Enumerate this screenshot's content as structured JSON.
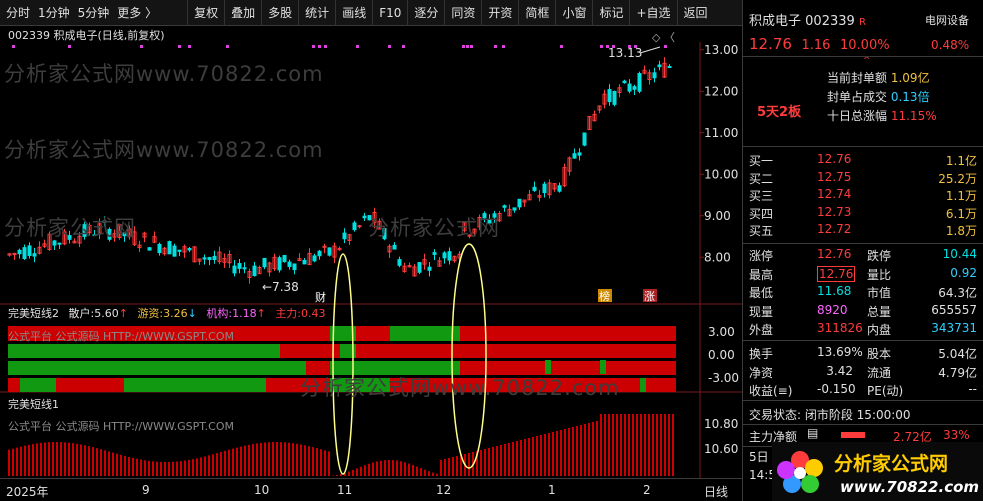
{
  "toolbar": {
    "left": [
      "分时",
      "1分钟",
      "5分钟",
      "更多 〉"
    ],
    "buttons": [
      "复权",
      "叠加",
      "多股",
      "统计",
      "画线",
      "F10",
      "逐分",
      "同资",
      "开资",
      "简框",
      "小窗",
      "标记",
      "+自选",
      "返回"
    ]
  },
  "chart_title": "002339 积成电子(日线,前复权)",
  "top_icons": "◇  〈",
  "watermark": "分析家公式网www.70822.com",
  "watermark_short": "分析家公式网",
  "annotations": {
    "high": "13.13",
    "low": "7.38",
    "cai": "财",
    "bang": "榜",
    "zhang": "涨"
  },
  "sub1": {
    "name": "完美短线2",
    "items": [
      {
        "label": "散户:",
        "value": "5.60",
        "color": "#e0e0e0",
        "arrow": "↑"
      },
      {
        "label": "游资:",
        "value": "3.26",
        "color": "#f0c040",
        "arrow": "↓"
      },
      {
        "label": "机构:",
        "value": "1.18",
        "color": "#ff66ff",
        "arrow": "↑"
      },
      {
        "label": "主力:",
        "value": "0.43",
        "color": "#ff3c3c",
        "arrow": ""
      }
    ],
    "axis": [
      "3.00",
      "0.00",
      "-3.00"
    ],
    "source_text": "公式平台 公式源码 HTTP://WWW.GSPT.COM"
  },
  "sub2": {
    "name": "完美短线1",
    "axis": [
      "10.80",
      "10.60"
    ],
    "source_text": "公式平台 公式源码 HTTP://WWW.GSPT.COM"
  },
  "xaxis": {
    "labels": [
      "2025年",
      "9",
      "10",
      "11",
      "12",
      "1",
      "2"
    ],
    "period": "日线"
  },
  "chart_data": {
    "type": "candlestick",
    "price_axis": [
      8.0,
      9.0,
      10.0,
      11.0,
      12.0,
      13.0
    ],
    "range": [
      7.0,
      13.5
    ],
    "high": 13.13,
    "low": 7.38,
    "last": 12.76
  },
  "right": {
    "name": "积成电子",
    "code": "002339",
    "flag": "R",
    "tag": "电网设备",
    "price": "12.76",
    "change": "1.16",
    "pct": "10.00%",
    "tag_pct": "0.48%",
    "limit_info": [
      {
        "label": "当前封单额",
        "value": "1.09亿"
      },
      {
        "label": "封单占成交",
        "value": "0.13倍"
      },
      {
        "label": "十日总涨幅",
        "value": "11.15%"
      }
    ],
    "streak": "5天2板",
    "bids": [
      {
        "label": "买一",
        "price": "12.76",
        "vol": "1.1亿"
      },
      {
        "label": "买二",
        "price": "12.75",
        "vol": "25.2万"
      },
      {
        "label": "买三",
        "price": "12.74",
        "vol": "1.1万"
      },
      {
        "label": "买四",
        "price": "12.73",
        "vol": "6.1万"
      },
      {
        "label": "买五",
        "price": "12.72",
        "vol": "1.8万"
      }
    ],
    "stats1": [
      {
        "l": "涨停",
        "v": "12.76",
        "r": "跌停",
        "rv": "10.44"
      },
      {
        "l": "最高",
        "v": "12.76",
        "r": "量比",
        "rv": "0.92"
      },
      {
        "l": "最低",
        "v": "11.68",
        "r": "市值",
        "rv": "64.3亿"
      },
      {
        "l": "现量",
        "v": "8920",
        "r": "总量",
        "rv": "655557"
      },
      {
        "l": "外盘",
        "v": "311826",
        "r": "内盘",
        "rv": "343731"
      }
    ],
    "stats2": [
      {
        "l": "换手",
        "v": "13.69%",
        "r": "股本",
        "rv": "5.04亿"
      },
      {
        "l": "净资",
        "v": "3.42",
        "r": "流通",
        "rv": "4.79亿"
      },
      {
        "l": "收益(≡)",
        "v": "-0.150",
        "r": "PE(动)",
        "rv": "--"
      }
    ],
    "trade_status": "交易状态: 闭市阶段 15:00:00",
    "main_net_label": "主力净额",
    "main_net_value": "2.72亿",
    "main_net_pct": "33%",
    "bottom_day": "5日",
    "bottom_time": "14:5",
    "logo_text": "分析家公式网",
    "logo_url": "www.70822.com"
  }
}
